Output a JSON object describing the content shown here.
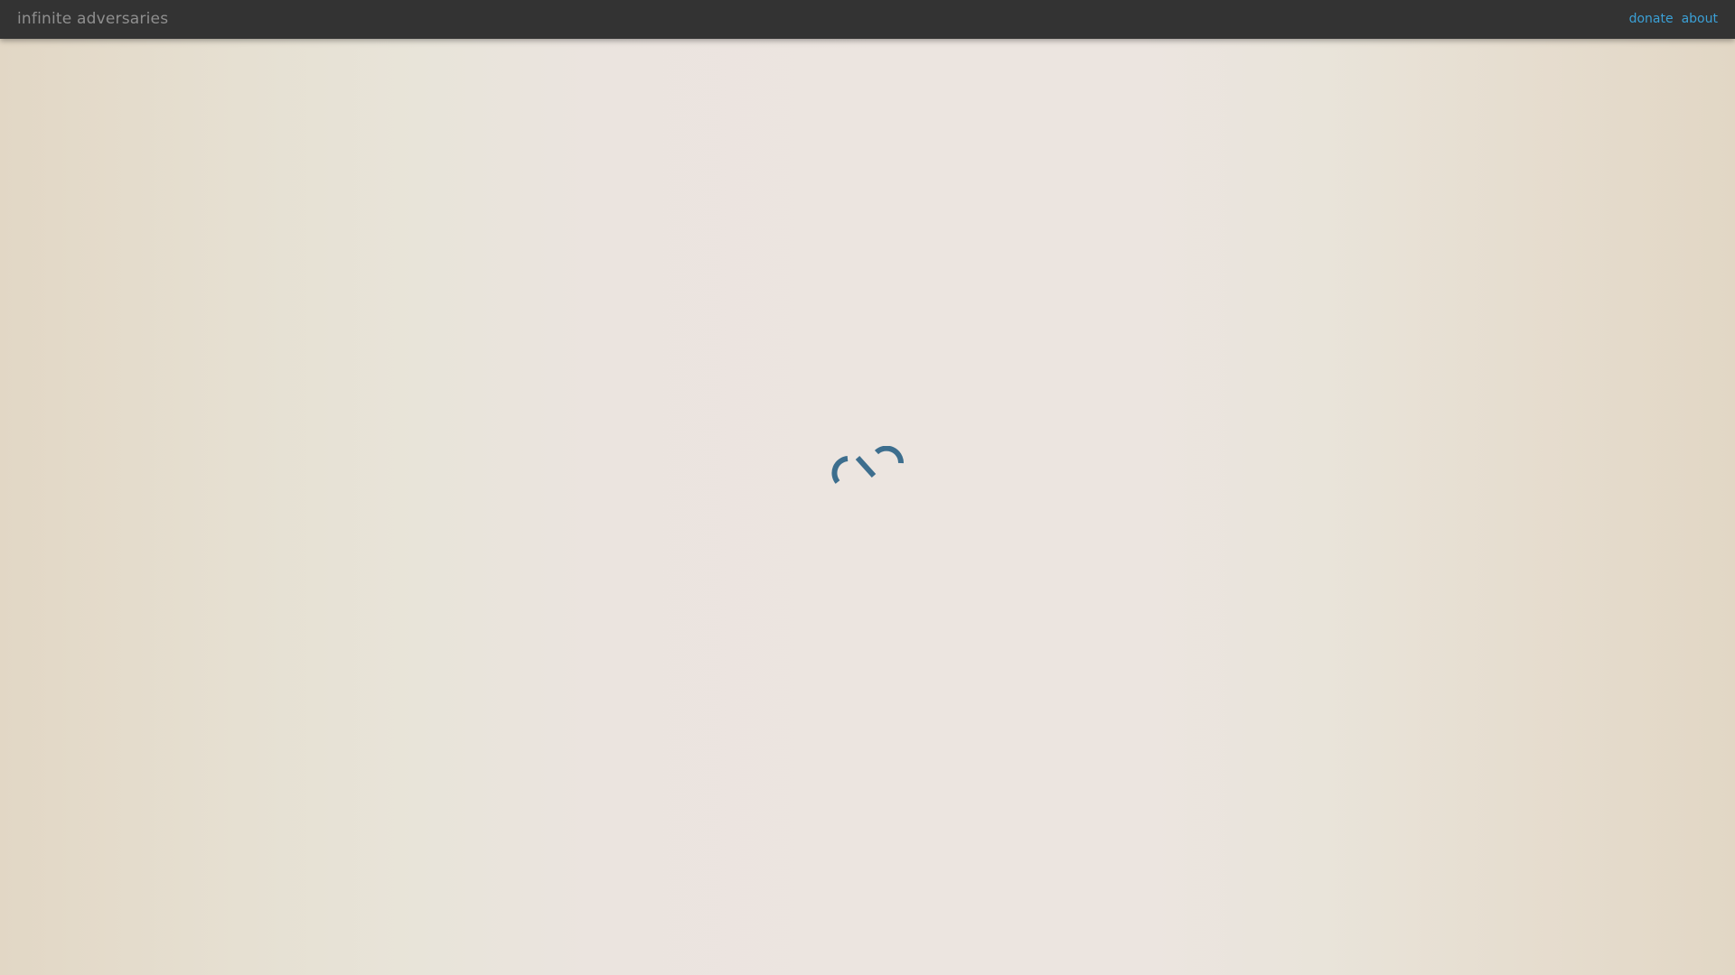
{
  "header": {
    "title": "infinite adversaries",
    "links": [
      {
        "label": "donate"
      },
      {
        "label": "about"
      }
    ]
  },
  "loading": {
    "icon": "loading-spinner-icon"
  },
  "colors": {
    "topbar": "#333333",
    "brand_text": "#8f8f8f",
    "link": "#3ba0d6",
    "spinner": "#3d6e8e"
  }
}
